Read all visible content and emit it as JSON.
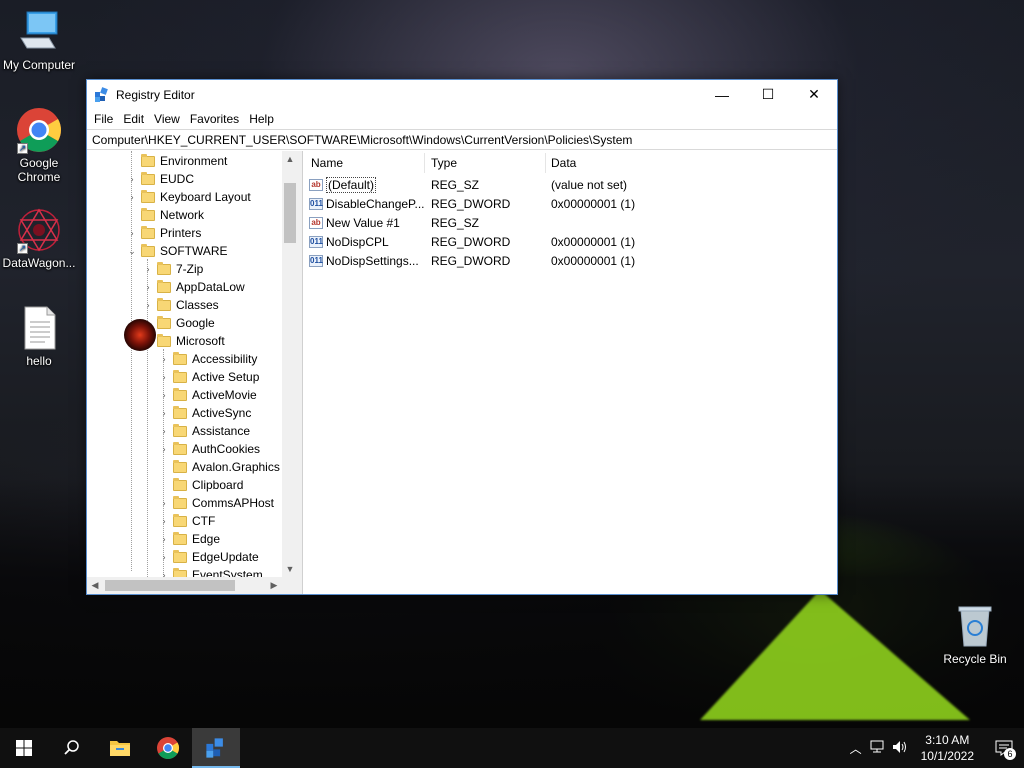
{
  "desktop": {
    "icons": [
      {
        "label": "My Computer"
      },
      {
        "label": "Google Chrome"
      },
      {
        "label": "DataWagon..."
      },
      {
        "label": "hello"
      },
      {
        "label": "Recycle Bin"
      }
    ]
  },
  "window": {
    "title": "Registry Editor",
    "controls": {
      "minimize": "—",
      "maximize": "☐",
      "close": "✕"
    },
    "menu": [
      "File",
      "Edit",
      "View",
      "Favorites",
      "Help"
    ],
    "address": "Computer\\HKEY_CURRENT_USER\\SOFTWARE\\Microsoft\\Windows\\CurrentVersion\\Policies\\System",
    "tree": [
      {
        "label": "Environment",
        "level": 1,
        "expander": ""
      },
      {
        "label": "EUDC",
        "level": 1,
        "expander": "›"
      },
      {
        "label": "Keyboard Layout",
        "level": 1,
        "expander": "›"
      },
      {
        "label": "Network",
        "level": 1,
        "expander": ""
      },
      {
        "label": "Printers",
        "level": 1,
        "expander": "›"
      },
      {
        "label": "SOFTWARE",
        "level": 1,
        "expander": "⌄"
      },
      {
        "label": "7-Zip",
        "level": 2,
        "expander": "›"
      },
      {
        "label": "AppDataLow",
        "level": 2,
        "expander": "›"
      },
      {
        "label": "Classes",
        "level": 2,
        "expander": "›"
      },
      {
        "label": "Google",
        "level": 2,
        "expander": "›"
      },
      {
        "label": "Microsoft",
        "level": 2,
        "expander": "⌄"
      },
      {
        "label": "Accessibility",
        "level": 3,
        "expander": "›"
      },
      {
        "label": "Active Setup",
        "level": 3,
        "expander": "›"
      },
      {
        "label": "ActiveMovie",
        "level": 3,
        "expander": "›"
      },
      {
        "label": "ActiveSync",
        "level": 3,
        "expander": "›"
      },
      {
        "label": "Assistance",
        "level": 3,
        "expander": "›"
      },
      {
        "label": "AuthCookies",
        "level": 3,
        "expander": "›"
      },
      {
        "label": "Avalon.Graphics",
        "level": 3,
        "expander": ""
      },
      {
        "label": "Clipboard",
        "level": 3,
        "expander": ""
      },
      {
        "label": "CommsAPHost",
        "level": 3,
        "expander": "›"
      },
      {
        "label": "CTF",
        "level": 3,
        "expander": "›"
      },
      {
        "label": "Edge",
        "level": 3,
        "expander": "›"
      },
      {
        "label": "EdgeUpdate",
        "level": 3,
        "expander": "›"
      },
      {
        "label": "EventSystem",
        "level": 3,
        "expander": "›"
      }
    ],
    "columns": {
      "name": "Name",
      "type": "Type",
      "data": "Data"
    },
    "values": [
      {
        "icon": "ab",
        "kind": "string-value-icon",
        "name": "(Default)",
        "type": "REG_SZ",
        "data": "(value not set)"
      },
      {
        "icon": "011",
        "kind": "dword-value-icon",
        "name": "DisableChangeP...",
        "type": "REG_DWORD",
        "data": "0x00000001 (1)"
      },
      {
        "icon": "ab",
        "kind": "string-value-icon",
        "name": "New Value #1",
        "type": "REG_SZ",
        "data": ""
      },
      {
        "icon": "011",
        "kind": "dword-value-icon",
        "name": "NoDispCPL",
        "type": "REG_DWORD",
        "data": "0x00000001 (1)"
      },
      {
        "icon": "011",
        "kind": "dword-value-icon",
        "name": "NoDispSettings...",
        "type": "REG_DWORD",
        "data": "0x00000001 (1)"
      }
    ]
  },
  "taskbar": {
    "time": "3:10 AM",
    "date": "10/1/2022",
    "notification_count": "6"
  },
  "colors": {
    "accent": "#0078d7",
    "taskbar": "#101010",
    "folder": "#f8d775"
  }
}
